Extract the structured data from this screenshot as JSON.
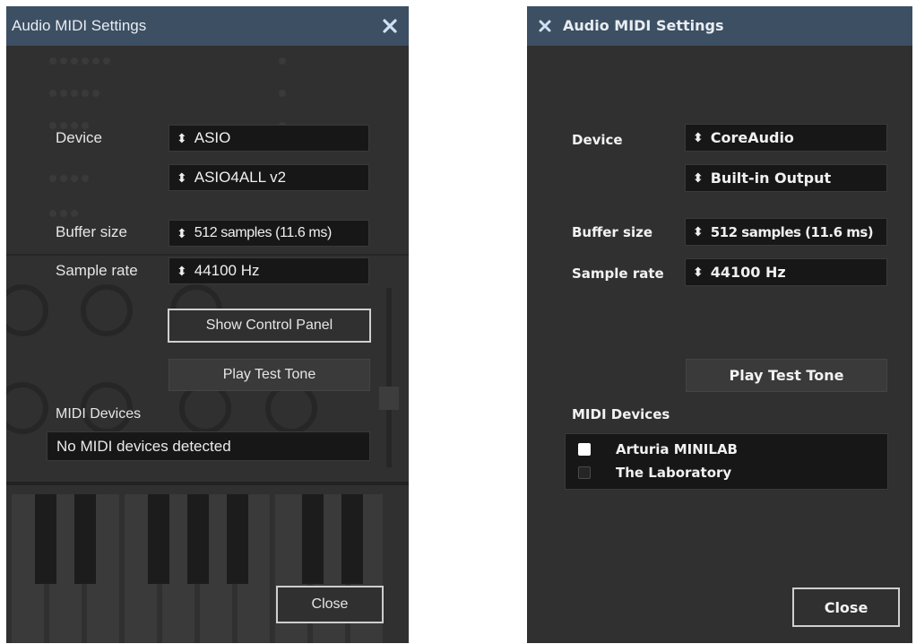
{
  "left_window": {
    "title": "Audio MIDI Settings",
    "device_label": "Device",
    "device_value": "ASIO",
    "driver_value": "ASIO4ALL v2",
    "buffer_label": "Buffer size",
    "buffer_value": "512 samples (11.6 ms)",
    "rate_label": "Sample rate",
    "rate_value": "44100 Hz",
    "control_panel_button": "Show Control Panel",
    "test_tone_button": "Play Test Tone",
    "midi_label": "MIDI Devices",
    "midi_message": "No MIDI devices detected",
    "close_button": "Close"
  },
  "right_window": {
    "title": "Audio MIDI Settings",
    "device_label": "Device",
    "device_value": "CoreAudio",
    "output_value": "Built-in Output",
    "buffer_label": "Buffer size",
    "buffer_value": "512 samples (11.6 ms)",
    "rate_label": "Sample rate",
    "rate_value": "44100 Hz",
    "test_tone_button": "Play Test Tone",
    "midi_label": "MIDI Devices",
    "midi_devices": [
      {
        "name": "Arturia MINILAB",
        "enabled": true
      },
      {
        "name": "The Laboratory",
        "enabled": false
      }
    ],
    "close_button": "Close"
  },
  "icons": {
    "select_arrows": "↕",
    "close": "close-icon"
  },
  "colors": {
    "titlebar": "#3c4f63",
    "panel": "#303030",
    "field": "#171717"
  }
}
